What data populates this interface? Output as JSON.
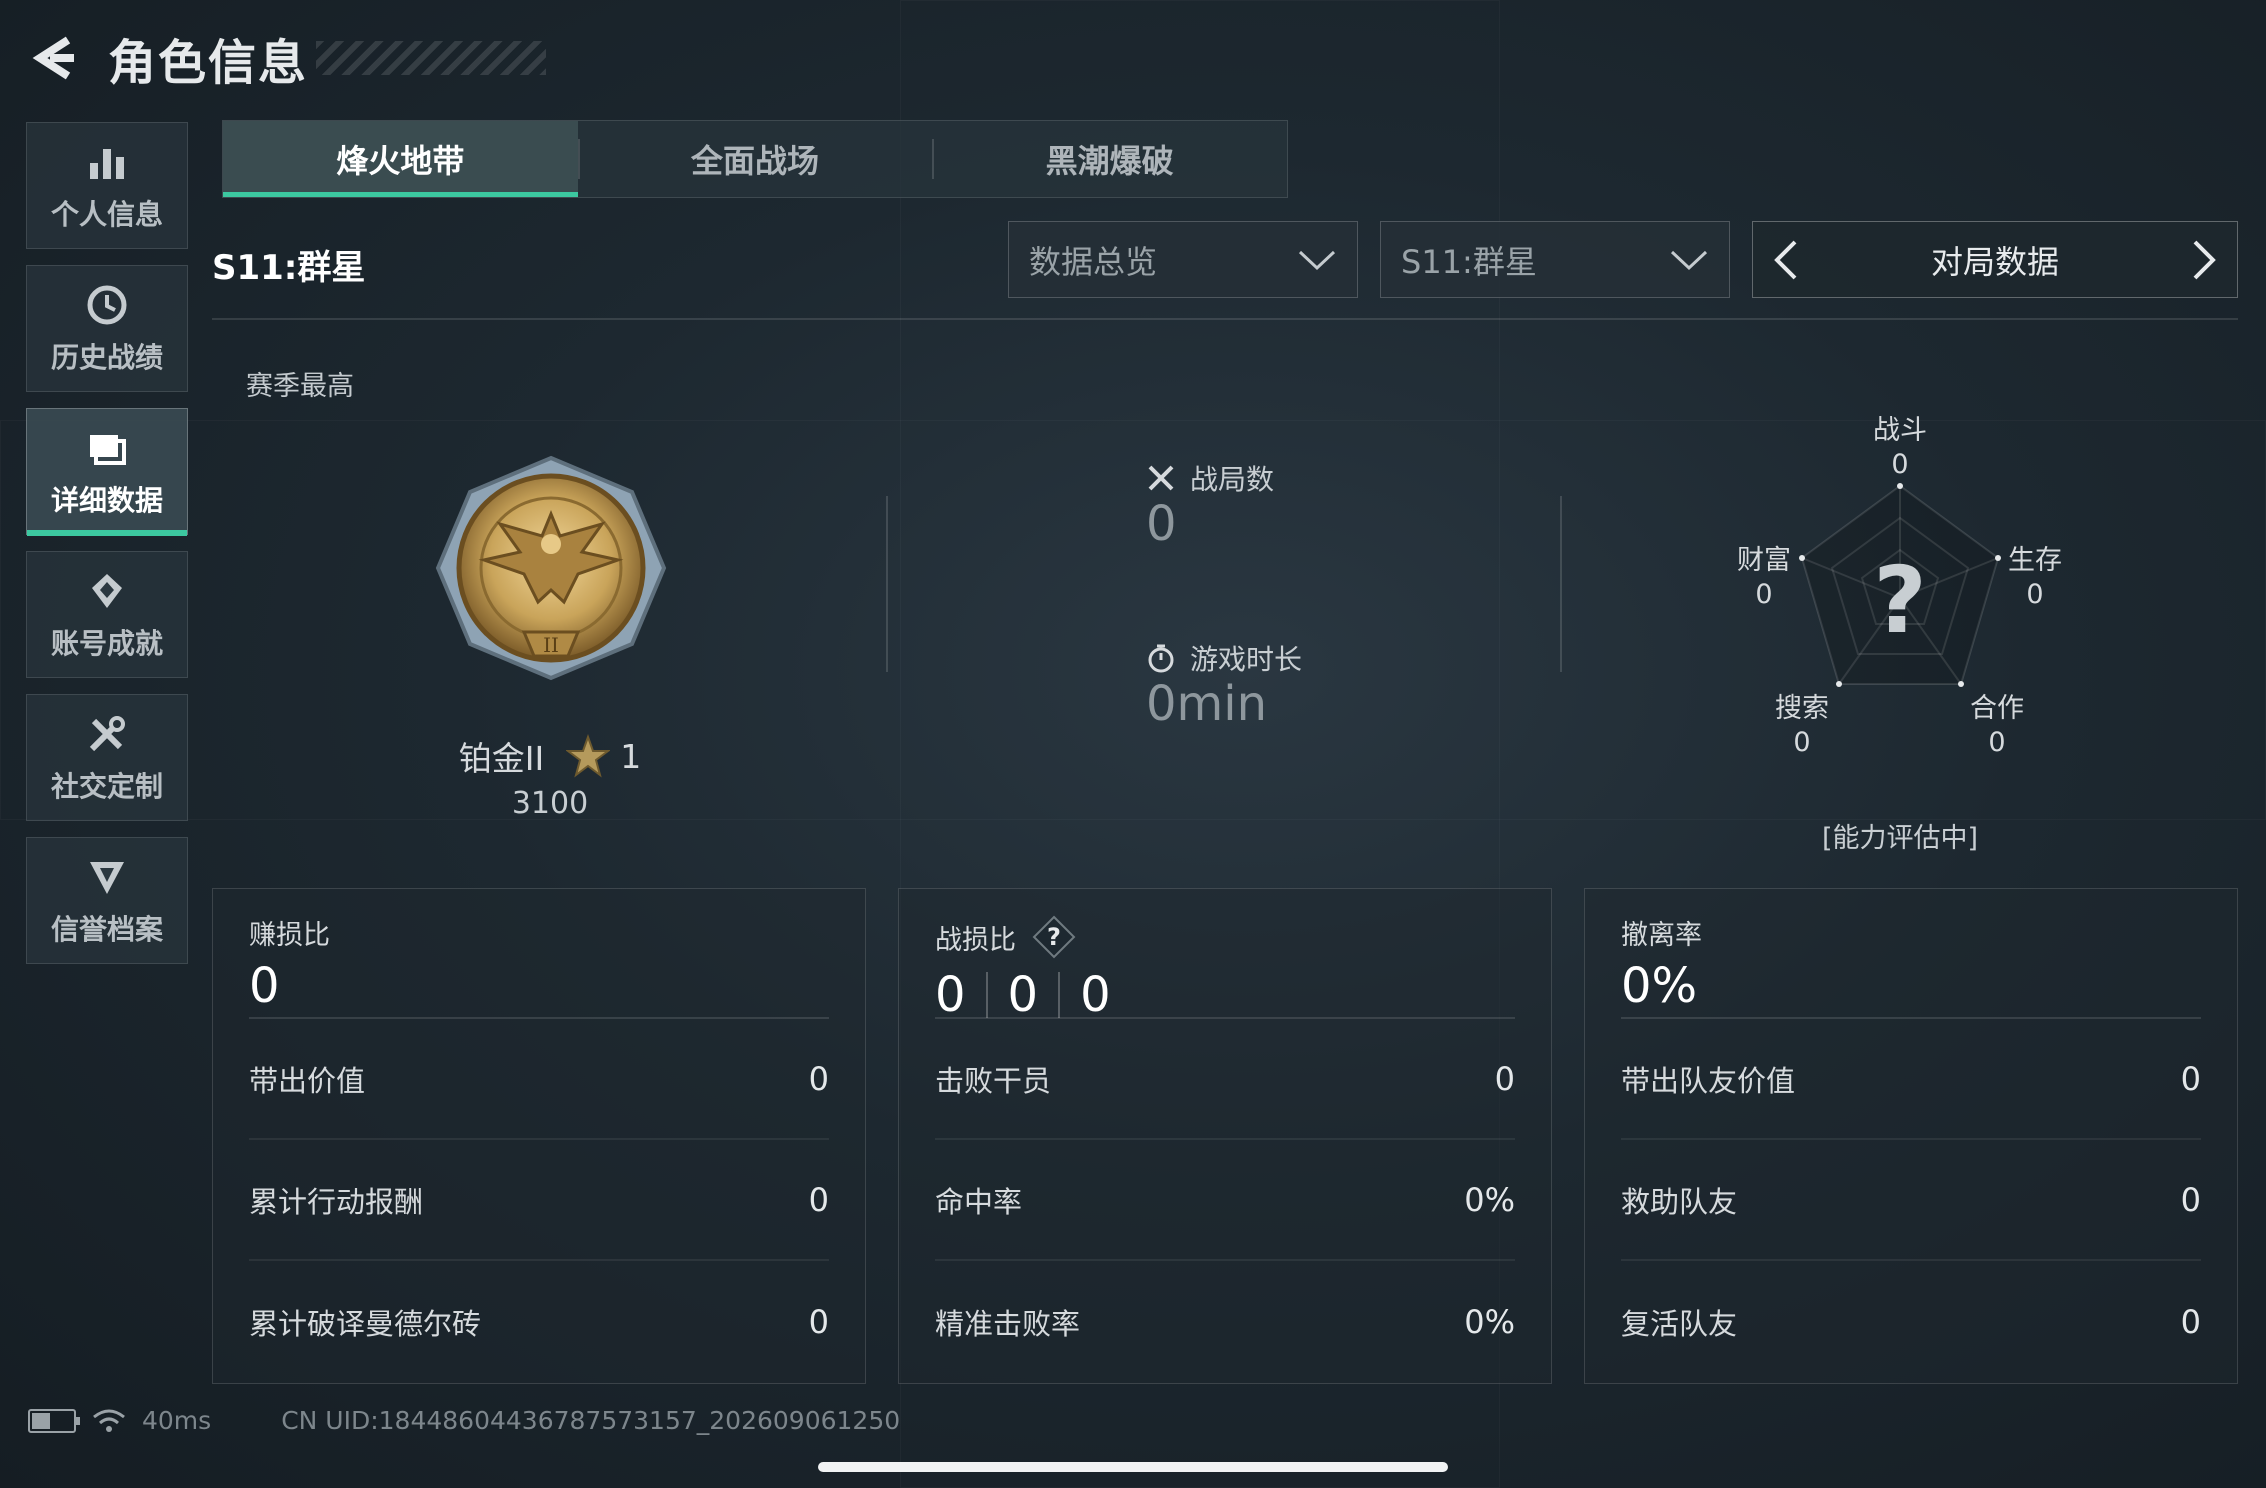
{
  "header": {
    "title": "角色信息"
  },
  "sidebar": {
    "items": [
      {
        "label": "个人信息",
        "icon": "bar-chart-icon"
      },
      {
        "label": "历史战绩",
        "icon": "history-clock-icon"
      },
      {
        "label": "详细数据",
        "icon": "folder-data-icon",
        "active": true
      },
      {
        "label": "账号成就",
        "icon": "achievement-icon"
      },
      {
        "label": "社交定制",
        "icon": "tools-icon"
      },
      {
        "label": "信誉档案",
        "icon": "credit-shield-icon"
      }
    ]
  },
  "tabs": [
    {
      "label": "烽火地带",
      "active": true
    },
    {
      "label": "全面战场"
    },
    {
      "label": "黑潮爆破"
    }
  ],
  "season_label": "S11:群星",
  "filters": {
    "overview": "数据总览",
    "season": "S11:群星",
    "pager_label": "对局数据"
  },
  "season_best": {
    "label": "赛季最高",
    "rank": "铂金II",
    "stars": "1",
    "score": "3100"
  },
  "match_stats": {
    "matches_label": "战局数",
    "matches_value": "0",
    "playtime_label": "游戏时长",
    "playtime_value": "0min"
  },
  "radar": {
    "center_symbol": "?",
    "status": "[能力评估中]",
    "axes": [
      {
        "label": "战斗",
        "value": "0"
      },
      {
        "label": "生存",
        "value": "0"
      },
      {
        "label": "合作",
        "value": "0"
      },
      {
        "label": "搜索",
        "value": "0"
      },
      {
        "label": "财富",
        "value": "0"
      }
    ]
  },
  "panels": [
    {
      "title": "赚损比",
      "big": [
        "0"
      ],
      "rows": [
        {
          "label": "带出价值",
          "value": "0"
        },
        {
          "label": "累计行动报酬",
          "value": "0"
        },
        {
          "label": "累计破译曼德尔砖",
          "value": "0"
        }
      ]
    },
    {
      "title": "战损比",
      "help": "?",
      "big": [
        "0",
        "0",
        "0"
      ],
      "rows": [
        {
          "label": "击败干员",
          "value": "0"
        },
        {
          "label": "命中率",
          "value": "0%"
        },
        {
          "label": "精准击败率",
          "value": "0%"
        }
      ]
    },
    {
      "title": "撤离率",
      "big": [
        "0%"
      ],
      "rows": [
        {
          "label": "带出队友价值",
          "value": "0"
        },
        {
          "label": "救助队友",
          "value": "0"
        },
        {
          "label": "复活队友",
          "value": "0"
        }
      ]
    }
  ],
  "footer": {
    "ping": "40ms",
    "uid": "CN UID:18448604436787573157_202609061250"
  },
  "colors": {
    "accent": "#3cc8a0",
    "background": "#1d2830",
    "badge_gold": "#c9a45a"
  }
}
